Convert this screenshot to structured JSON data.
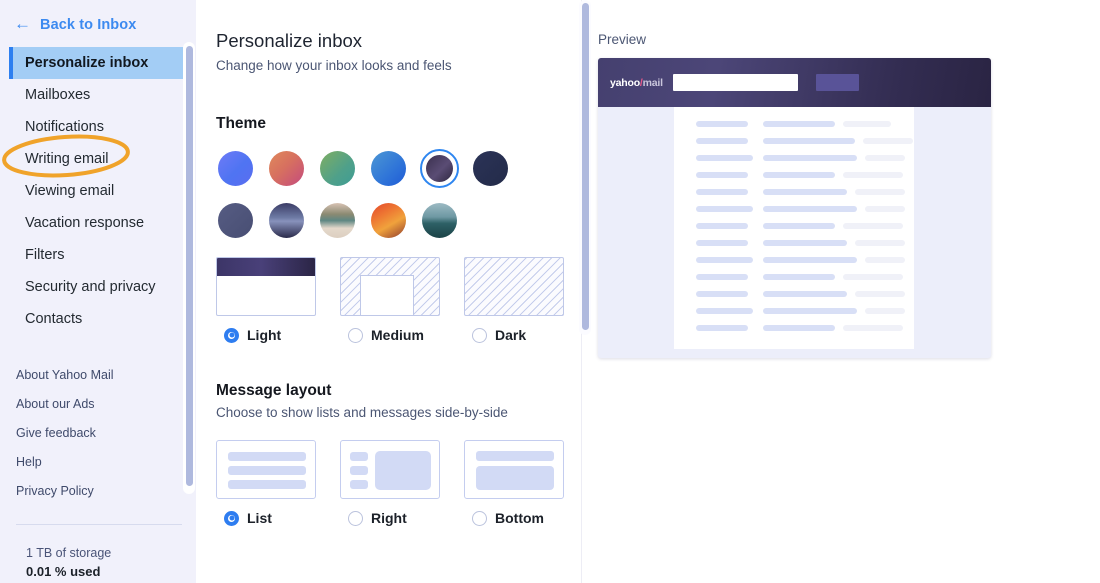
{
  "sidebar": {
    "back": {
      "label": "Back to Inbox",
      "icon": "arrow-left-icon",
      "glyph": "←"
    },
    "nav_items": [
      {
        "label": "Personalize inbox",
        "active": true
      },
      {
        "label": "Mailboxes",
        "active": false
      },
      {
        "label": "Notifications",
        "active": false
      },
      {
        "label": "Writing email",
        "active": false,
        "annotated": true
      },
      {
        "label": "Viewing email",
        "active": false
      },
      {
        "label": "Vacation response",
        "active": false
      },
      {
        "label": "Filters",
        "active": false
      },
      {
        "label": "Security and privacy",
        "active": false
      },
      {
        "label": "Contacts",
        "active": false
      }
    ],
    "links": [
      "About Yahoo Mail",
      "About our Ads",
      "Give feedback",
      "Help",
      "Privacy Policy"
    ],
    "storage": {
      "total": "1 TB of storage",
      "used": "0.01 % used"
    }
  },
  "main": {
    "title": "Personalize inbox",
    "subtitle": "Change how your inbox looks and feels",
    "theme": {
      "heading": "Theme",
      "swatches_row1": [
        {
          "name": "blue-violet-gradient",
          "selected": false,
          "css": "linear-gradient(135deg,#6E7BF7 0%,#4F74F2 55%,#5B6DF0 100%)"
        },
        {
          "name": "sunset-pink-gradient",
          "selected": false,
          "css": "linear-gradient(135deg,#E08A5C 0%,#D7705F 45%,#C44A7E 100%)"
        },
        {
          "name": "green-teal-gradient",
          "selected": false,
          "css": "linear-gradient(135deg,#7FAE62 0%,#4FA08A 60%,#3E9D95 100%)"
        },
        {
          "name": "ocean-blue-gradient",
          "selected": false,
          "css": "linear-gradient(135deg,#4C97D4 0%,#2F74D8 60%,#1F5BD6 100%)"
        },
        {
          "name": "dark-violet-gradient",
          "selected": true,
          "css": "linear-gradient(135deg,#3A2F4E 0%,#5A4C74 55%,#2E2740 100%)"
        },
        {
          "name": "navy-solid",
          "selected": false,
          "css": "linear-gradient(135deg,#2B3357 0%,#232B49 100%)"
        }
      ],
      "swatches_row2": [
        {
          "name": "slate-purple-solid",
          "selected": false,
          "css": "linear-gradient(135deg,#565C83 0%,#484E73 100%)"
        },
        {
          "name": "mountain-night-photo",
          "selected": false,
          "css": "linear-gradient(180deg,#3B3C66 0%,#6E7BA5 45%,#2A2A4A 100%)"
        },
        {
          "name": "desert-camper-photo",
          "selected": false,
          "css": "linear-gradient(180deg,#D8C3B4 0%,#6E7F6C 38%,#E4D8CB 100%)"
        },
        {
          "name": "orange-sunset-photo",
          "selected": false,
          "css": "linear-gradient(160deg,#E4472B 0%,#F0A23C 45%,#8E3A2E 100%)"
        },
        {
          "name": "island-sea-photo",
          "selected": false,
          "css": "linear-gradient(180deg,#8FB2BE 0%,#5F8F9C 45%,#1F4E52 100%)"
        }
      ],
      "density_options": [
        {
          "label": "Light",
          "selected": true,
          "style": "light"
        },
        {
          "label": "Medium",
          "selected": false,
          "style": "medium"
        },
        {
          "label": "Dark",
          "selected": false,
          "style": "dark"
        }
      ]
    },
    "message_layout": {
      "heading": "Message layout",
      "subtitle": "Choose to show lists and messages side-by-side",
      "options": [
        {
          "label": "List",
          "selected": true,
          "style": "list"
        },
        {
          "label": "Right",
          "selected": false,
          "style": "right"
        },
        {
          "label": "Bottom",
          "selected": false,
          "style": "bottom"
        }
      ]
    }
  },
  "preview": {
    "label": "Preview",
    "logo": {
      "name": "yahoo-mail-logo",
      "part1": "yahoo",
      "slash": "/",
      "part2": "mail"
    }
  },
  "annotation": {
    "target": "Writing email",
    "shape": "ellipse",
    "color": "#F0A32A"
  },
  "colors": {
    "accent_blue": "#2E7DF0",
    "link_blue": "#3C8AF0",
    "sidebar_bg": "#F1F1FB",
    "active_item_bg": "#A3CDF5",
    "annotation_orange": "#F0A32A"
  }
}
